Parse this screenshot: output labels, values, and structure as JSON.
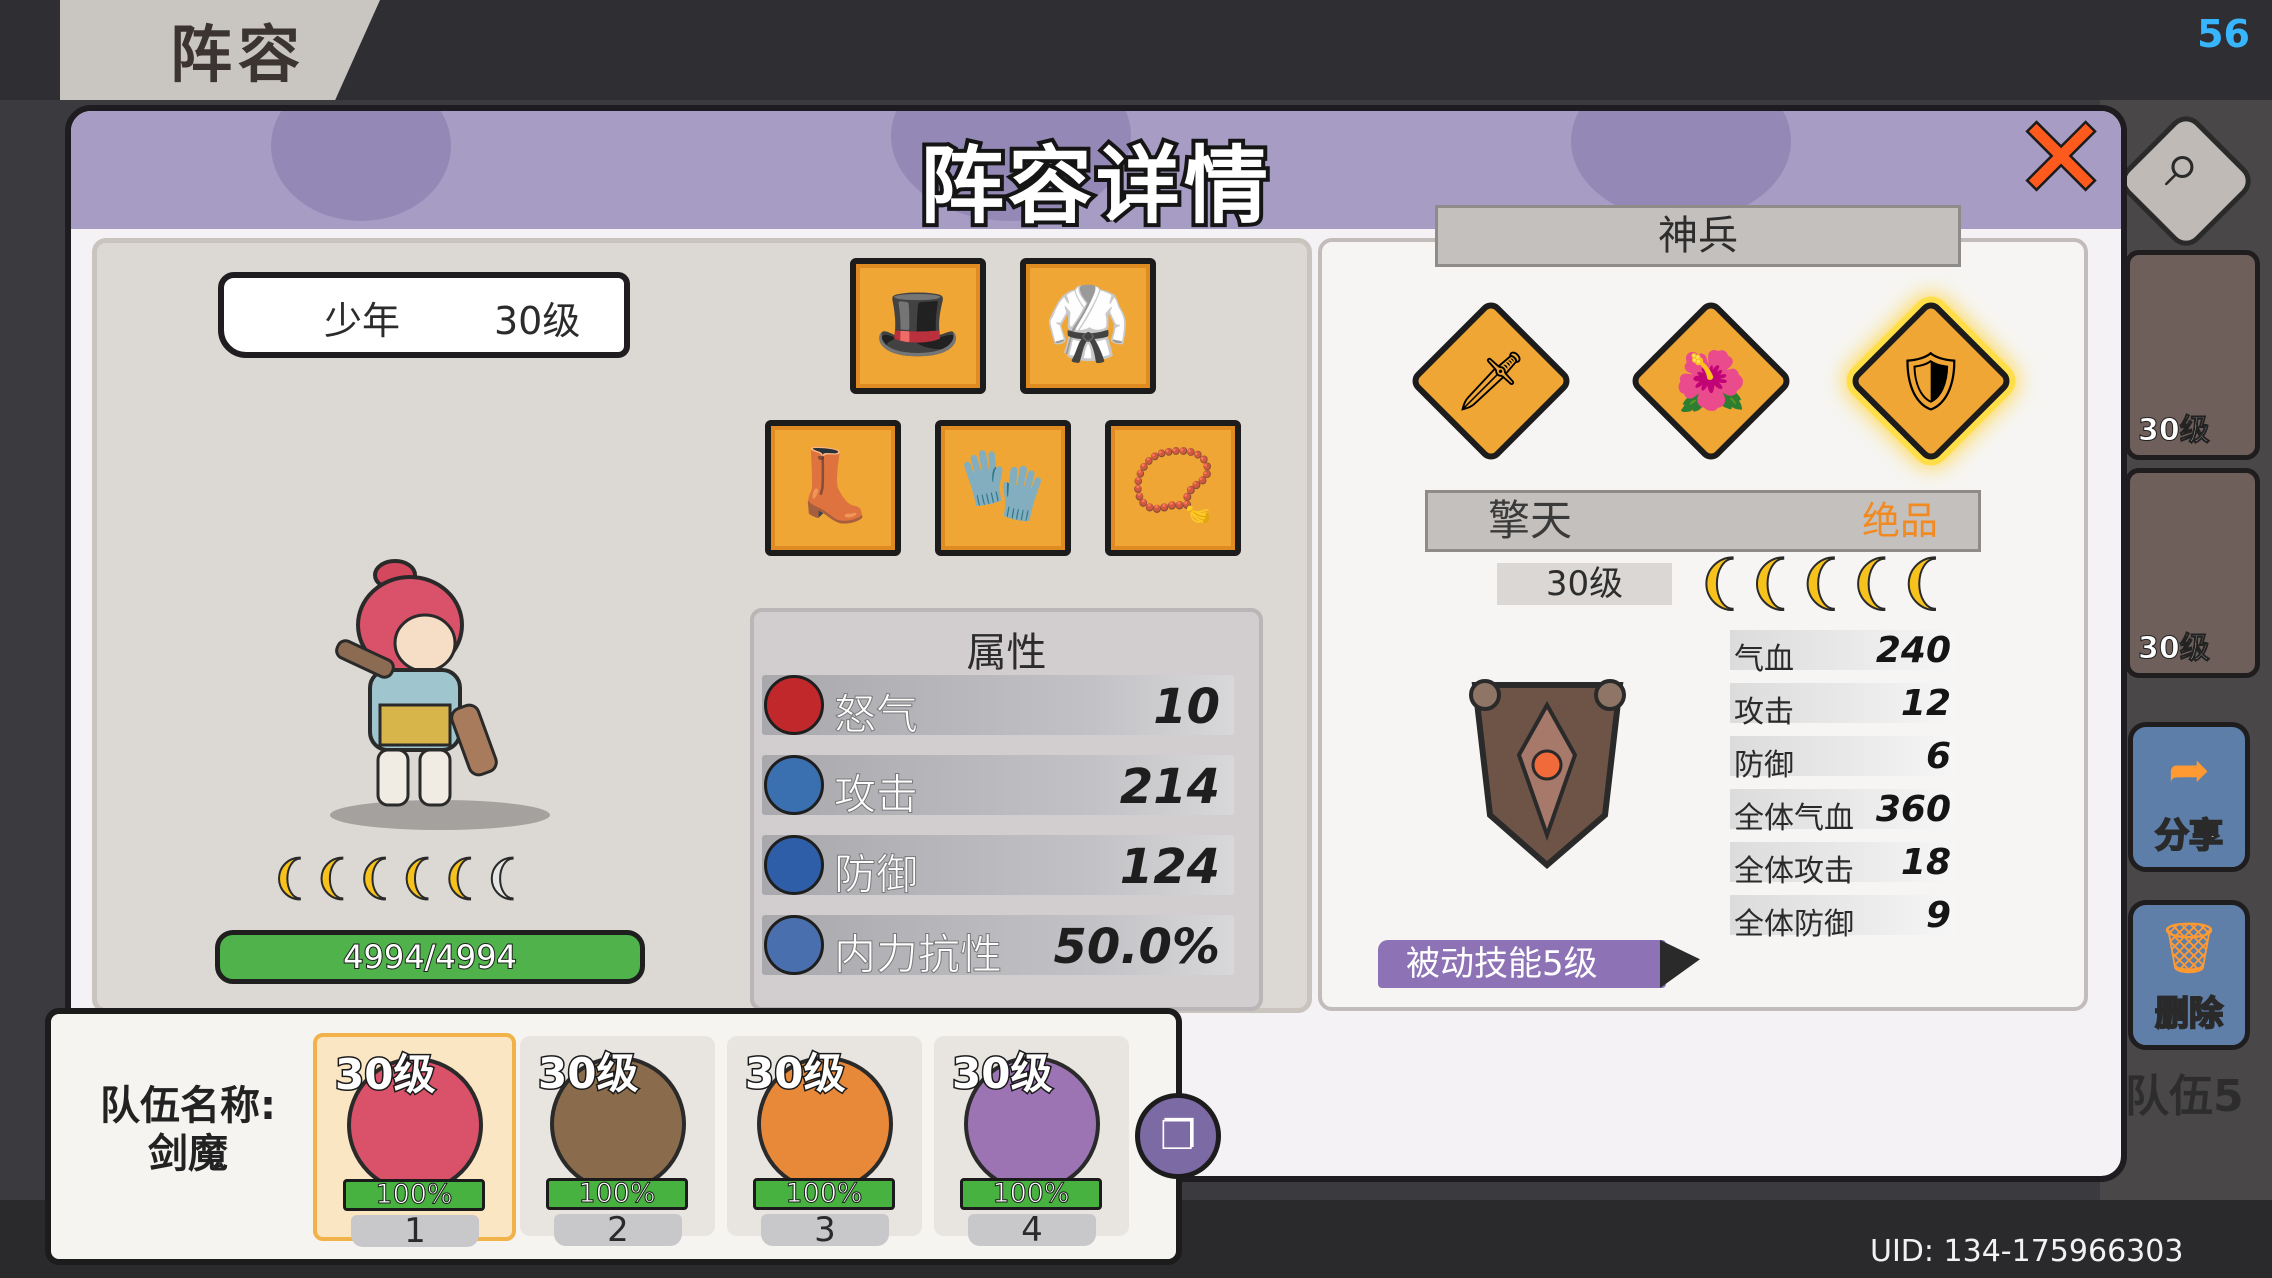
{
  "screen": {
    "title": "阵容",
    "fps": "56",
    "uid": "UID: 134-175966303"
  },
  "dialog": {
    "title": "阵容详情"
  },
  "hero": {
    "name": "少年",
    "level": "30级",
    "stars": "⬤⬤⬤⬤⬤⬤",
    "star_count": 6,
    "hp": "4994/4994",
    "equipment": [
      "hat",
      "armor",
      "boots",
      "gloves",
      "beads"
    ]
  },
  "attributes": {
    "title": "属性",
    "rows": [
      {
        "label": "怒气",
        "value": "10",
        "color": "#c0282c"
      },
      {
        "label": "攻击",
        "value": "214",
        "color": "#3a6fb0"
      },
      {
        "label": "防御",
        "value": "124",
        "color": "#2f5ea8"
      },
      {
        "label": "内力抗性",
        "value": "50.0%",
        "color": "#4a6fae"
      }
    ]
  },
  "weapon": {
    "section_title": "神兵",
    "slots": [
      "weapon-1",
      "weapon-2",
      "weapon-3"
    ],
    "name": "擎天",
    "quality": "绝品",
    "level": "30级",
    "stars": "❨❨❨❨❨",
    "stats": [
      {
        "label": "气血",
        "value": "240"
      },
      {
        "label": "攻击",
        "value": "12"
      },
      {
        "label": "防御",
        "value": "6"
      },
      {
        "label": "全体气血",
        "value": "360"
      },
      {
        "label": "全体攻击",
        "value": "18"
      },
      {
        "label": "全体防御",
        "value": "9"
      }
    ],
    "skill": "被动技能5级"
  },
  "team": {
    "label_line1": "队伍名称:",
    "label_line2": "剑魔",
    "members": [
      {
        "level": "30级",
        "hp": "100%",
        "slot": "1"
      },
      {
        "level": "30级",
        "hp": "100%",
        "slot": "2"
      },
      {
        "level": "30级",
        "hp": "100%",
        "slot": "3"
      },
      {
        "level": "30级",
        "hp": "100%",
        "slot": "4"
      }
    ]
  },
  "side": {
    "cards": [
      {
        "level": "30级"
      },
      {
        "level": "30级"
      }
    ],
    "share": "分享",
    "delete": "删除",
    "team5": "队伍5"
  }
}
